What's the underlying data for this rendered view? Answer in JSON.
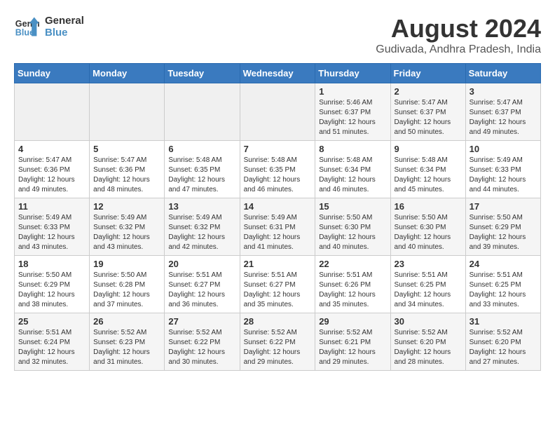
{
  "header": {
    "logo_line1": "General",
    "logo_line2": "Blue",
    "main_title": "August 2024",
    "subtitle": "Gudivada, Andhra Pradesh, India"
  },
  "days_of_week": [
    "Sunday",
    "Monday",
    "Tuesday",
    "Wednesday",
    "Thursday",
    "Friday",
    "Saturday"
  ],
  "weeks": [
    [
      {
        "day": "",
        "info": ""
      },
      {
        "day": "",
        "info": ""
      },
      {
        "day": "",
        "info": ""
      },
      {
        "day": "",
        "info": ""
      },
      {
        "day": "1",
        "info": "Sunrise: 5:46 AM\nSunset: 6:37 PM\nDaylight: 12 hours\nand 51 minutes."
      },
      {
        "day": "2",
        "info": "Sunrise: 5:47 AM\nSunset: 6:37 PM\nDaylight: 12 hours\nand 50 minutes."
      },
      {
        "day": "3",
        "info": "Sunrise: 5:47 AM\nSunset: 6:37 PM\nDaylight: 12 hours\nand 49 minutes."
      }
    ],
    [
      {
        "day": "4",
        "info": "Sunrise: 5:47 AM\nSunset: 6:36 PM\nDaylight: 12 hours\nand 49 minutes."
      },
      {
        "day": "5",
        "info": "Sunrise: 5:47 AM\nSunset: 6:36 PM\nDaylight: 12 hours\nand 48 minutes."
      },
      {
        "day": "6",
        "info": "Sunrise: 5:48 AM\nSunset: 6:35 PM\nDaylight: 12 hours\nand 47 minutes."
      },
      {
        "day": "7",
        "info": "Sunrise: 5:48 AM\nSunset: 6:35 PM\nDaylight: 12 hours\nand 46 minutes."
      },
      {
        "day": "8",
        "info": "Sunrise: 5:48 AM\nSunset: 6:34 PM\nDaylight: 12 hours\nand 46 minutes."
      },
      {
        "day": "9",
        "info": "Sunrise: 5:48 AM\nSunset: 6:34 PM\nDaylight: 12 hours\nand 45 minutes."
      },
      {
        "day": "10",
        "info": "Sunrise: 5:49 AM\nSunset: 6:33 PM\nDaylight: 12 hours\nand 44 minutes."
      }
    ],
    [
      {
        "day": "11",
        "info": "Sunrise: 5:49 AM\nSunset: 6:33 PM\nDaylight: 12 hours\nand 43 minutes."
      },
      {
        "day": "12",
        "info": "Sunrise: 5:49 AM\nSunset: 6:32 PM\nDaylight: 12 hours\nand 43 minutes."
      },
      {
        "day": "13",
        "info": "Sunrise: 5:49 AM\nSunset: 6:32 PM\nDaylight: 12 hours\nand 42 minutes."
      },
      {
        "day": "14",
        "info": "Sunrise: 5:49 AM\nSunset: 6:31 PM\nDaylight: 12 hours\nand 41 minutes."
      },
      {
        "day": "15",
        "info": "Sunrise: 5:50 AM\nSunset: 6:30 PM\nDaylight: 12 hours\nand 40 minutes."
      },
      {
        "day": "16",
        "info": "Sunrise: 5:50 AM\nSunset: 6:30 PM\nDaylight: 12 hours\nand 40 minutes."
      },
      {
        "day": "17",
        "info": "Sunrise: 5:50 AM\nSunset: 6:29 PM\nDaylight: 12 hours\nand 39 minutes."
      }
    ],
    [
      {
        "day": "18",
        "info": "Sunrise: 5:50 AM\nSunset: 6:29 PM\nDaylight: 12 hours\nand 38 minutes."
      },
      {
        "day": "19",
        "info": "Sunrise: 5:50 AM\nSunset: 6:28 PM\nDaylight: 12 hours\nand 37 minutes."
      },
      {
        "day": "20",
        "info": "Sunrise: 5:51 AM\nSunset: 6:27 PM\nDaylight: 12 hours\nand 36 minutes."
      },
      {
        "day": "21",
        "info": "Sunrise: 5:51 AM\nSunset: 6:27 PM\nDaylight: 12 hours\nand 35 minutes."
      },
      {
        "day": "22",
        "info": "Sunrise: 5:51 AM\nSunset: 6:26 PM\nDaylight: 12 hours\nand 35 minutes."
      },
      {
        "day": "23",
        "info": "Sunrise: 5:51 AM\nSunset: 6:25 PM\nDaylight: 12 hours\nand 34 minutes."
      },
      {
        "day": "24",
        "info": "Sunrise: 5:51 AM\nSunset: 6:25 PM\nDaylight: 12 hours\nand 33 minutes."
      }
    ],
    [
      {
        "day": "25",
        "info": "Sunrise: 5:51 AM\nSunset: 6:24 PM\nDaylight: 12 hours\nand 32 minutes."
      },
      {
        "day": "26",
        "info": "Sunrise: 5:52 AM\nSunset: 6:23 PM\nDaylight: 12 hours\nand 31 minutes."
      },
      {
        "day": "27",
        "info": "Sunrise: 5:52 AM\nSunset: 6:22 PM\nDaylight: 12 hours\nand 30 minutes."
      },
      {
        "day": "28",
        "info": "Sunrise: 5:52 AM\nSunset: 6:22 PM\nDaylight: 12 hours\nand 29 minutes."
      },
      {
        "day": "29",
        "info": "Sunrise: 5:52 AM\nSunset: 6:21 PM\nDaylight: 12 hours\nand 29 minutes."
      },
      {
        "day": "30",
        "info": "Sunrise: 5:52 AM\nSunset: 6:20 PM\nDaylight: 12 hours\nand 28 minutes."
      },
      {
        "day": "31",
        "info": "Sunrise: 5:52 AM\nSunset: 6:20 PM\nDaylight: 12 hours\nand 27 minutes."
      }
    ]
  ]
}
